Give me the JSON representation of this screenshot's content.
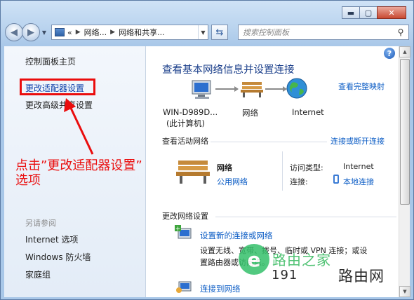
{
  "window": {
    "minimize_glyph": "▬",
    "maximize_glyph": "▢",
    "close_glyph": "✕"
  },
  "navbar": {
    "back_icon": "back-arrow-icon",
    "forward_icon": "forward-arrow-icon",
    "breadcrumb_prefix": "«",
    "breadcrumb": [
      "网络...",
      "网络和共享..."
    ],
    "search_placeholder": "搜索控制面板"
  },
  "sidebar": {
    "home": "控制面板主页",
    "adapter_settings": "更改适配器设置",
    "advanced_sharing": "更改高级共享设置",
    "see_also_header": "另请参阅",
    "see_also": [
      "Internet 选项",
      "Windows 防火墙",
      "家庭组"
    ]
  },
  "annotation": {
    "line1": "点击”更改适配器设置”",
    "line2": "选项",
    "color": "#ea1010"
  },
  "main": {
    "help": "?",
    "title": "查看基本网络信息并设置连接",
    "full_map_link": "查看完整映射",
    "map": {
      "computer_name": "WIN-D989D...",
      "computer_sub": "(此计算机)",
      "network_label": "网络",
      "internet_label": "Internet"
    },
    "active_header": "查看活动网络",
    "connect_disconnect_link": "连接或断开连接",
    "active_network": {
      "name": "网络",
      "type": "公用网络",
      "access_type_label": "访问类型:",
      "access_type_value": "Internet",
      "connections_label": "连接:",
      "connections_value": "本地连接"
    },
    "change_header": "更改网络设置",
    "tasks": [
      {
        "title": "设置新的连接或网络",
        "desc1": "设置无线、宽带、拨号、临时或 VPN 连接；或设",
        "desc2": "置路由器或访问点。"
      },
      {
        "title": "连接到网络"
      }
    ]
  },
  "watermark": {
    "logo_letter": "e",
    "text_top": "路由之家",
    "text_num": "191",
    "text_bottom": "路由网"
  }
}
